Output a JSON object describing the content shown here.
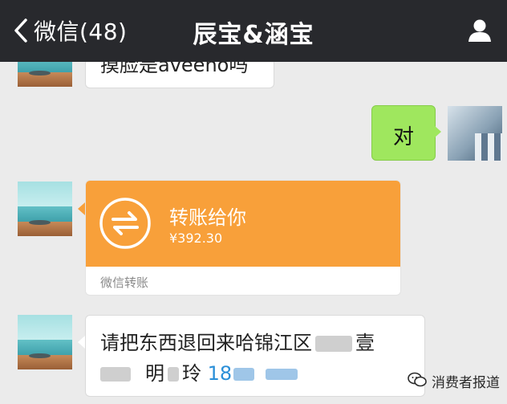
{
  "nav": {
    "back_label": "微信(48)",
    "title": "辰宝&涵宝",
    "back_icon": "chevron-left-icon",
    "profile_icon": "person-icon"
  },
  "messages": {
    "top_partial": "摸脸是aveeno吗",
    "right_reply": "对",
    "transfer": {
      "title": "转账给你",
      "amount": "¥392.30",
      "footer": "微信转账",
      "icon": "transfer-arrows-icon",
      "color": "#f8a03a"
    },
    "address": {
      "line1": "请把东西退回来哈锦江区",
      "line1_end": "壹",
      "line2_mid": "明",
      "line2_name": "玲",
      "line2_phone": "18"
    }
  },
  "watermark": {
    "text": "消费者报道",
    "icon": "wechat-logo-icon"
  },
  "colors": {
    "navbar": "#28292d",
    "background": "#ebebeb",
    "sent_bubble": "#9fe75e",
    "phone_link": "#2a8fd8"
  }
}
